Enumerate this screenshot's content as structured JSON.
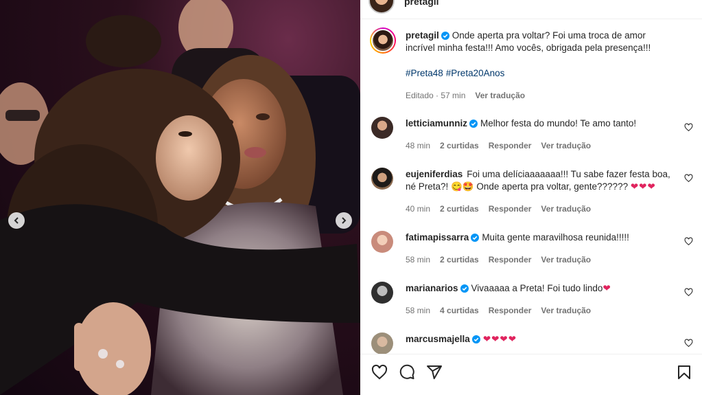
{
  "header": {
    "username": "pretagil"
  },
  "caption": {
    "username": "pretagil",
    "text": "Onde aperta pra voltar? Foi uma troca de amor incrível minha festa!!! Amo vocês, obrigada pela presença!!!",
    "hashtags": [
      "#Preta48",
      "#Preta20Anos"
    ],
    "edited": "Editado · 57 min",
    "see_translation": "Ver tradução"
  },
  "comments": [
    {
      "username": "letticiamunniz",
      "text": "Melhor festa do mundo! Te amo tanto!",
      "time": "48 min",
      "likes": "2 curtidas",
      "reply": "Responder",
      "translate": "Ver tradução",
      "avatar_color": "#3b2a26"
    },
    {
      "username": "eujeniferdias",
      "text": "Foi uma delíciaaaaaaa!!! Tu sabe fazer festa boa, né Preta?! 😋🤩 Onde aperta pra voltar, gente??????",
      "hearts": "❤❤❤",
      "time": "40 min",
      "likes": "2 curtidas",
      "reply": "Responder",
      "translate": "Ver tradução",
      "avatar_color": "#8b6a4f"
    },
    {
      "username": "fatimapissarra",
      "text": "Muita gente maravilhosa reunida!!!!!",
      "time": "58 min",
      "likes": "2 curtidas",
      "reply": "Responder",
      "translate": "Ver tradução",
      "avatar_color": "#c98b7b"
    },
    {
      "username": "marianarios",
      "text": "Vivaaaaa a Preta! Foi tudo lindo",
      "hearts": "❤",
      "time": "58 min",
      "likes": "4 curtidas",
      "reply": "Responder",
      "translate": "Ver tradução",
      "avatar_color": "#4a4a4a"
    },
    {
      "username": "marcusmajella",
      "text": "",
      "hearts": "❤❤❤❤",
      "time": "",
      "likes": "",
      "reply": "",
      "translate": "",
      "avatar_color": "#9c8f7a"
    }
  ],
  "colors": {
    "link": "#00376b",
    "verified": "#0095f6",
    "heart": "#e0245e",
    "muted": "#737373"
  },
  "icons": [
    "heart-icon",
    "comment-icon",
    "share-icon",
    "bookmark-icon",
    "chevron-left-icon",
    "chevron-right-icon",
    "verified-badge-icon"
  ]
}
